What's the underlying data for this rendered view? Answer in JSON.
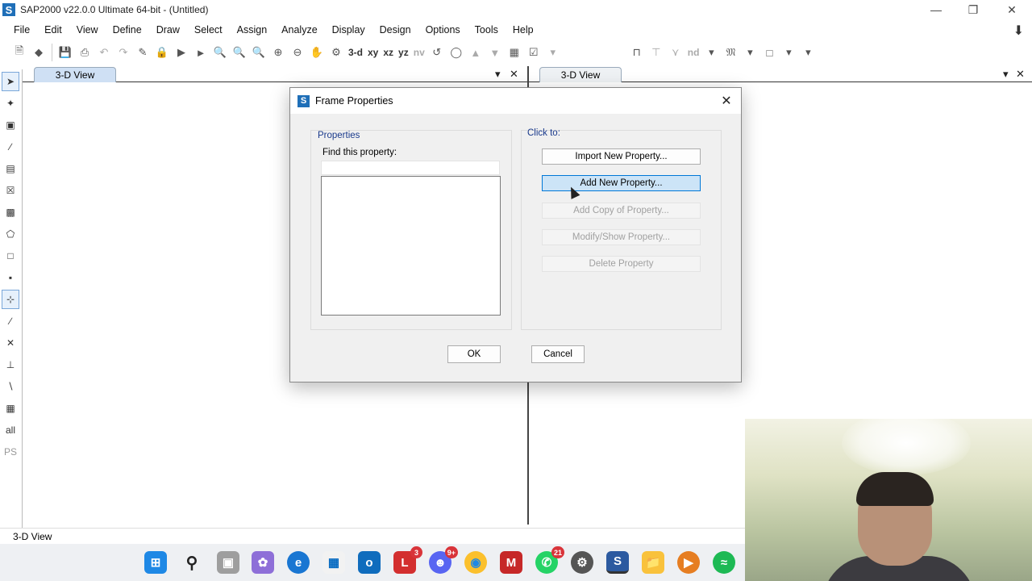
{
  "window": {
    "title": "SAP2000 v22.0.0 Ultimate 64-bit - (Untitled)",
    "app_logo": "S"
  },
  "menu": [
    "File",
    "Edit",
    "View",
    "Define",
    "Draw",
    "Select",
    "Assign",
    "Analyze",
    "Display",
    "Design",
    "Options",
    "Tools",
    "Help"
  ],
  "toolbar": {
    "view_labels": [
      "3-d",
      "xy",
      "xz",
      "yz",
      "nv"
    ],
    "nd_label": "nd"
  },
  "panes": {
    "left_tab": "3-D View",
    "right_tab": "3-D View"
  },
  "status": {
    "text": "3-D View"
  },
  "left_tools": {
    "all_label": "all",
    "ps_label": "PS"
  },
  "taskbar": {
    "lexmark_badge": "3",
    "discord_badge": "9+",
    "whatsapp_badge": "21"
  },
  "dialog": {
    "title": "Frame Properties",
    "logo": "S",
    "properties_group": "Properties",
    "find_label": "Find this property:",
    "find_value": "",
    "click_to_label": "Click to:",
    "buttons": {
      "import": "Import New Property...",
      "add_new": "Add New Property...",
      "add_copy": "Add Copy of Property...",
      "modify": "Modify/Show Property...",
      "delete": "Delete Property"
    },
    "ok": "OK",
    "cancel": "Cancel"
  },
  "colors": {
    "accent": "#0078d7",
    "tab_active": "#cfe0f4",
    "brand": "#1f6fb8"
  }
}
